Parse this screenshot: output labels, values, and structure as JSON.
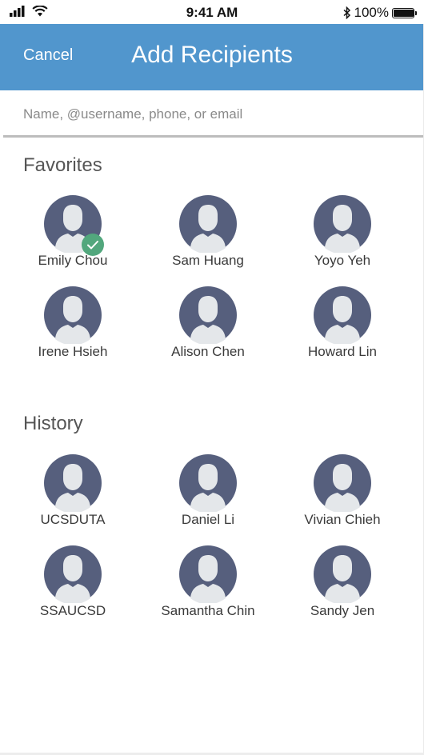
{
  "status_bar": {
    "time": "9:41 AM",
    "battery_percent": "100%",
    "battery_level": 1.0
  },
  "header": {
    "cancel_label": "Cancel",
    "title": "Add Recipients",
    "background_color": "#5196cd"
  },
  "search": {
    "placeholder": "Name, @username, phone, or email",
    "value": ""
  },
  "favorites": {
    "title": "Favorites",
    "contacts": [
      {
        "name": "Emily Chou",
        "selected": true
      },
      {
        "name": "Sam Huang",
        "selected": false
      },
      {
        "name": "Yoyo Yeh",
        "selected": false
      },
      {
        "name": "Irene Hsieh",
        "selected": false
      },
      {
        "name": "Alison Chen",
        "selected": false
      },
      {
        "name": "Howard Lin",
        "selected": false
      }
    ]
  },
  "history": {
    "title": "History",
    "contacts": [
      {
        "name": "UCSDUTA",
        "selected": false
      },
      {
        "name": "Daniel Li",
        "selected": false
      },
      {
        "name": "Vivian Chieh",
        "selected": false
      },
      {
        "name": "SSAUCSD",
        "selected": false
      },
      {
        "name": "Samantha Chin",
        "selected": false
      },
      {
        "name": "Sandy Jen",
        "selected": false
      }
    ]
  },
  "colors": {
    "avatar_bg": "#565f7d",
    "avatar_figure": "#e4e7ea",
    "check_badge": "#52a77d"
  },
  "icons": {
    "signal": "cellular-signal-icon",
    "wifi": "wifi-icon",
    "bluetooth": "bluetooth-icon",
    "battery": "battery-icon",
    "avatar": "person-placeholder-icon",
    "check": "check-badge-icon"
  }
}
